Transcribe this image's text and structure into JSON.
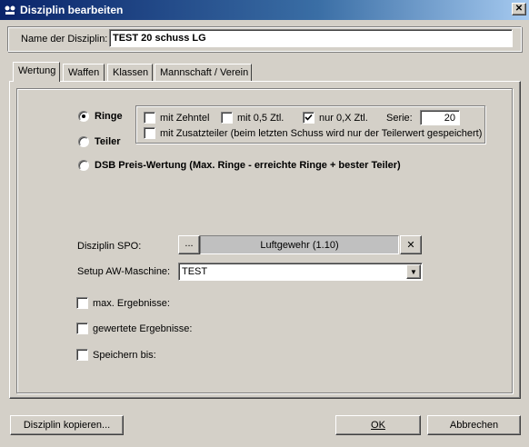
{
  "window": {
    "title": "Disziplin bearbeiten",
    "close_glyph": "✕"
  },
  "name_field": {
    "label": "Name der Disziplin:",
    "value": "TEST 20 schuss LG"
  },
  "tabs": [
    {
      "label": "Wertung",
      "active": true
    },
    {
      "label": "Waffen",
      "active": false
    },
    {
      "label": "Klassen",
      "active": false
    },
    {
      "label": "Mannschaft / Verein",
      "active": false
    }
  ],
  "wertung": {
    "radios": {
      "ringe": {
        "label": "Ringe",
        "selected": true
      },
      "teiler": {
        "label": "Teiler",
        "selected": false
      },
      "dsb": {
        "label": "DSB Preis-Wertung (Max. Ringe - erreichte Ringe + bester Teiler)",
        "selected": false
      }
    },
    "options": {
      "zehntel": {
        "label": "mit Zehntel",
        "checked": false
      },
      "ztl05": {
        "label": "mit 0,5 Ztl.",
        "checked": false
      },
      "ztl0x": {
        "label": "nur 0,X Ztl.",
        "checked": true
      },
      "serie_label": "Serie:",
      "serie_value": "20",
      "zusatzteiler": {
        "label": "mit Zusatzteiler (beim letzten Schuss wird nur der Teilerwert gespeichert)",
        "checked": false
      }
    },
    "spo": {
      "label": "Disziplin SPO:",
      "browse_label": "...",
      "value": "Luftgewehr (1.10)",
      "clear_glyph": "✕"
    },
    "setup": {
      "label": "Setup AW-Maschine:",
      "value": "TEST",
      "dropdown_glyph": "▼"
    },
    "checks": {
      "max": {
        "label": "max. Ergebnisse:",
        "checked": false
      },
      "gewertet": {
        "label": "gewertete Ergebnisse:",
        "checked": false
      },
      "speichern": {
        "label": "Speichern bis:",
        "checked": false
      }
    }
  },
  "footer": {
    "copy_label": "Disziplin kopieren...",
    "ok_label": "OK",
    "cancel_label": "Abbrechen"
  },
  "colors": {
    "titlebar_start": "#0a246a",
    "titlebar_end": "#a6caf0",
    "face": "#d4d0c8"
  }
}
